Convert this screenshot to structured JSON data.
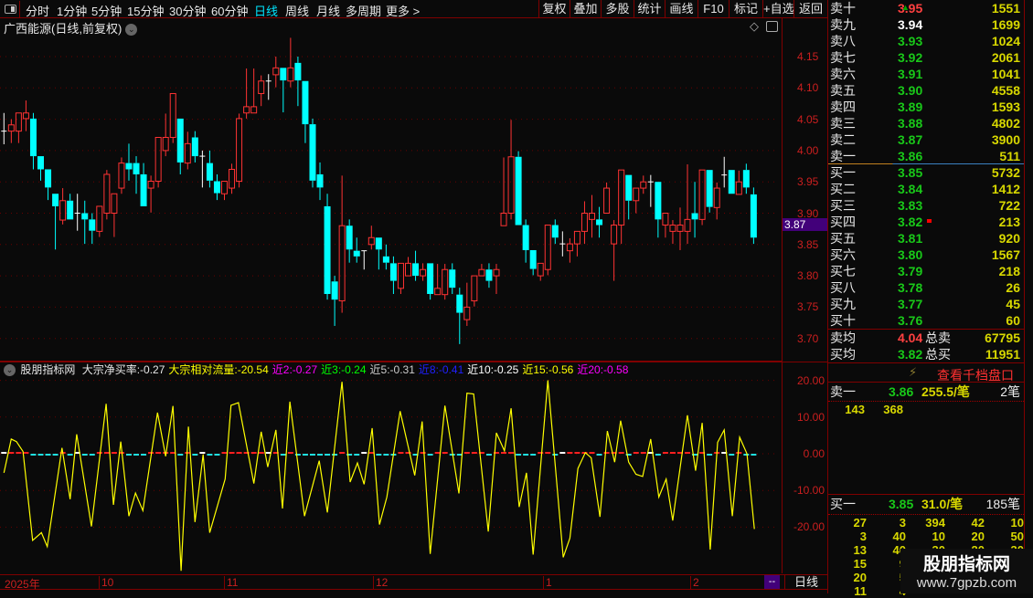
{
  "toolbar": {
    "tabs": [
      "分时",
      "1分钟",
      "5分钟",
      "15分钟",
      "30分钟",
      "60分钟",
      "日线",
      "周线",
      "月线",
      "多周期",
      "更多 >"
    ],
    "active_tab": "日线",
    "buttons": [
      "复权",
      "叠加",
      "多股",
      "统计",
      "画线",
      "F10",
      "标记",
      "+自选",
      "返回"
    ]
  },
  "title": "广西能源(日线,前复权)",
  "price_axis": {
    "ticks": [
      "4.15",
      "4.10",
      "4.05",
      "4.00",
      "3.95",
      "3.90",
      "3.85",
      "3.80",
      "3.75",
      "3.70"
    ],
    "last_price": "3.87"
  },
  "indicator": {
    "name": "股朋指标网",
    "items": [
      {
        "text": "大宗净买率:-0.27",
        "color": "#e8e8e8"
      },
      {
        "text": "大宗相对流量:-20.54",
        "color": "#ffff00"
      },
      {
        "text": "近2:-0.27",
        "color": "#ff00ff"
      },
      {
        "text": "近3:-0.24",
        "color": "#00ff00"
      },
      {
        "text": "近5:-0.31",
        "color": "#cccccc"
      },
      {
        "text": "近8:-0.41",
        "color": "#2020ff"
      },
      {
        "text": "近10:-0.25",
        "color": "#ffffff"
      },
      {
        "text": "近15:-0.56",
        "color": "#ffff00"
      },
      {
        "text": "近20:-0.58",
        "color": "#ff00ff"
      }
    ],
    "ticks": [
      "20.00",
      "10.00",
      "0.00",
      "-10.00",
      "-20.00"
    ]
  },
  "date_axis": {
    "labels": [
      "2025年",
      "10",
      "11",
      "12",
      "1",
      "2"
    ],
    "period_box": "--",
    "period": "日线"
  },
  "order_book": {
    "asks": [
      [
        "卖十",
        "3.95",
        "1551"
      ],
      [
        "卖九",
        "3.94",
        "1699"
      ],
      [
        "卖八",
        "3.93",
        "1024"
      ],
      [
        "卖七",
        "3.92",
        "2061"
      ],
      [
        "卖六",
        "3.91",
        "1041"
      ],
      [
        "卖五",
        "3.90",
        "4558"
      ],
      [
        "卖四",
        "3.89",
        "1593"
      ],
      [
        "卖三",
        "3.88",
        "4802"
      ],
      [
        "卖二",
        "3.87",
        "3900"
      ],
      [
        "卖一",
        "3.86",
        "511"
      ]
    ],
    "bids": [
      [
        "买一",
        "3.85",
        "5732"
      ],
      [
        "买二",
        "3.84",
        "1412"
      ],
      [
        "买三",
        "3.83",
        "722"
      ],
      [
        "买四",
        "3.82",
        "213"
      ],
      [
        "买五",
        "3.81",
        "920"
      ],
      [
        "买六",
        "3.80",
        "1567"
      ],
      [
        "买七",
        "3.79",
        "218"
      ],
      [
        "买八",
        "3.78",
        "26"
      ],
      [
        "买九",
        "3.77",
        "45"
      ],
      [
        "买十",
        "3.76",
        "60"
      ]
    ],
    "ask_avg": {
      "label": "卖均",
      "price": "4.04",
      "total_label": "总卖",
      "total": "67795"
    },
    "bid_avg": {
      "label": "买均",
      "price": "3.82",
      "total_label": "总买",
      "total": "11951"
    }
  },
  "depth": {
    "link": "查看千档盘口",
    "ask1": {
      "label": "卖一",
      "price": "3.86",
      "avg": "255.5/笔",
      "count": "2笔",
      "orders": [
        "143",
        "368"
      ]
    },
    "bid1": {
      "label": "买一",
      "price": "3.85",
      "avg": "31.0/笔",
      "count": "185笔",
      "orders": [
        [
          "27",
          "3",
          "394",
          "42",
          "10"
        ],
        [
          "3",
          "40",
          "10",
          "20",
          "50"
        ],
        [
          "13",
          "40",
          "30",
          "20",
          "30"
        ],
        [
          "15",
          "9"
        ],
        [
          "20",
          "5"
        ],
        [
          "11",
          "4"
        ]
      ]
    }
  },
  "watermark": {
    "name": "股朋指标网",
    "url": "www.7gpzb.com"
  },
  "colors": {
    "up": "#ff3333",
    "down": "#00ffff",
    "flat": "#ffffff",
    "line": "#ffff00",
    "grid": "#6a0000",
    "axis": "#cc1f1f"
  },
  "chart_data": [
    {
      "type": "candlestick",
      "title": "广西能源(日线,前复权)",
      "ylim": [
        3.67,
        4.18
      ],
      "fields": [
        "open",
        "high",
        "low",
        "close"
      ],
      "ohlc": [
        [
          4.031,
          4.06,
          4.01,
          4.031
        ],
        [
          4.031,
          4.05,
          4.012,
          4.041
        ],
        [
          4.031,
          4.06,
          4.012,
          4.06
        ],
        [
          4.051,
          4.08,
          4.031,
          4.06
        ],
        [
          4.051,
          4.06,
          3.97,
          3.991
        ],
        [
          3.991,
          3.991,
          3.952,
          3.97
        ],
        [
          3.97,
          3.97,
          3.921,
          3.941
        ],
        [
          3.931,
          3.931,
          3.842,
          3.911
        ],
        [
          3.889,
          3.94,
          3.882,
          3.92
        ],
        [
          3.92,
          3.931,
          3.89,
          3.89
        ],
        [
          3.9,
          3.931,
          3.872,
          3.9
        ],
        [
          3.9,
          3.92,
          3.851,
          3.89
        ],
        [
          3.89,
          3.9,
          3.851,
          3.872
        ],
        [
          3.871,
          3.911,
          3.862,
          3.911
        ],
        [
          3.9,
          3.969,
          3.89,
          3.962
        ],
        [
          3.9,
          3.931,
          3.862,
          3.931
        ],
        [
          3.94,
          3.989,
          3.931,
          3.98
        ],
        [
          3.98,
          4.011,
          3.952,
          3.97
        ],
        [
          3.98,
          3.991,
          3.931,
          3.962
        ],
        [
          3.962,
          3.98,
          3.911,
          3.911
        ],
        [
          3.94,
          3.96,
          3.901,
          3.951
        ],
        [
          3.951,
          4.021,
          3.941,
          4.021
        ],
        [
          4.0,
          4.059,
          3.991,
          4.021
        ],
        [
          4.021,
          4.091,
          4.012,
          4.091
        ],
        [
          4.051,
          4.051,
          3.962,
          3.981
        ],
        [
          3.98,
          4.03,
          3.97,
          4.011
        ],
        [
          4.021,
          4.031,
          3.981,
          3.991
        ],
        [
          3.991,
          4.0,
          3.941,
          3.991
        ],
        [
          3.98,
          4.0,
          3.941,
          3.952
        ],
        [
          3.951,
          3.962,
          3.921,
          3.932
        ],
        [
          3.931,
          3.951,
          3.921,
          3.951
        ],
        [
          3.94,
          3.979,
          3.931,
          3.97
        ],
        [
          3.951,
          4.059,
          3.941,
          4.051
        ],
        [
          4.06,
          4.131,
          4.051,
          4.07
        ],
        [
          4.06,
          4.131,
          4.06,
          4.07
        ],
        [
          4.091,
          4.12,
          4.071,
          4.111
        ],
        [
          4.111,
          4.122,
          4.081,
          4.111
        ],
        [
          4.121,
          4.15,
          4.101,
          4.132
        ],
        [
          4.132,
          4.132,
          4.061,
          4.112
        ],
        [
          4.111,
          4.18,
          4.101,
          4.132
        ],
        [
          4.14,
          4.15,
          4.071,
          4.112
        ],
        [
          4.111,
          4.111,
          4.012,
          4.042
        ],
        [
          4.042,
          4.051,
          3.941,
          3.952
        ],
        [
          3.962,
          3.981,
          3.921,
          3.941
        ],
        [
          3.911,
          3.931,
          3.762,
          3.771
        ],
        [
          3.791,
          3.8,
          3.72,
          3.762
        ],
        [
          3.76,
          3.96,
          3.741,
          3.88
        ],
        [
          3.88,
          3.89,
          3.821,
          3.842
        ],
        [
          3.84,
          3.861,
          3.821,
          3.831
        ],
        [
          3.84,
          3.84,
          3.81,
          3.84
        ],
        [
          3.85,
          3.88,
          3.842,
          3.861
        ],
        [
          3.861,
          3.861,
          3.81,
          3.842
        ],
        [
          3.831,
          3.85,
          3.81,
          3.821
        ],
        [
          3.82,
          3.831,
          3.771,
          3.792
        ],
        [
          3.78,
          3.82,
          3.771,
          3.82
        ],
        [
          3.8,
          3.83,
          3.8,
          3.82
        ],
        [
          3.82,
          3.84,
          3.792,
          3.8
        ],
        [
          3.8,
          3.82,
          3.792,
          3.81
        ],
        [
          3.82,
          3.82,
          3.762,
          3.771
        ],
        [
          3.77,
          3.819,
          3.77,
          3.78
        ],
        [
          3.77,
          3.819,
          3.762,
          3.81
        ],
        [
          3.81,
          3.82,
          3.771,
          3.781
        ],
        [
          3.77,
          3.781,
          3.691,
          3.741
        ],
        [
          3.73,
          3.789,
          3.72,
          3.75
        ],
        [
          3.76,
          3.8,
          3.751,
          3.8
        ],
        [
          3.8,
          3.819,
          3.8,
          3.81
        ],
        [
          3.81,
          3.82,
          3.781,
          3.792
        ],
        [
          3.8,
          3.819,
          3.771,
          3.81
        ],
        [
          3.88,
          3.989,
          3.88,
          3.9
        ],
        [
          3.9,
          4.049,
          3.89,
          3.99
        ],
        [
          3.99,
          3.999,
          3.881,
          3.881
        ],
        [
          3.881,
          3.89,
          3.821,
          3.841
        ],
        [
          3.841,
          3.841,
          3.801,
          3.811
        ],
        [
          3.8,
          3.82,
          3.792,
          3.82
        ],
        [
          3.81,
          3.881,
          3.801,
          3.881
        ],
        [
          3.881,
          3.89,
          3.851,
          3.861
        ],
        [
          3.851,
          3.871,
          3.831,
          3.851
        ],
        [
          3.84,
          3.86,
          3.821,
          3.851
        ],
        [
          3.851,
          3.871,
          3.831,
          3.871
        ],
        [
          3.871,
          3.919,
          3.851,
          3.9
        ],
        [
          3.89,
          3.929,
          3.861,
          3.9
        ],
        [
          3.89,
          3.91,
          3.861,
          3.881
        ],
        [
          3.9,
          3.949,
          3.9,
          3.94
        ],
        [
          3.851,
          3.889,
          3.792,
          3.881
        ],
        [
          3.881,
          3.969,
          3.851,
          3.969
        ],
        [
          3.961,
          3.961,
          3.89,
          3.92
        ],
        [
          3.92,
          3.94,
          3.9,
          3.94
        ],
        [
          3.94,
          3.96,
          3.931,
          3.95
        ],
        [
          3.95,
          3.961,
          3.91,
          3.95
        ],
        [
          3.95,
          3.95,
          3.861,
          3.89
        ],
        [
          3.881,
          3.9,
          3.861,
          3.9
        ],
        [
          3.871,
          3.889,
          3.851,
          3.881
        ],
        [
          3.871,
          3.909,
          3.841,
          3.881
        ],
        [
          3.871,
          3.978,
          3.851,
          3.89
        ],
        [
          3.9,
          3.95,
          3.861,
          3.89
        ],
        [
          3.89,
          3.969,
          3.881,
          3.969
        ],
        [
          3.969,
          3.969,
          3.901,
          3.91
        ],
        [
          3.909,
          3.949,
          3.89,
          3.94
        ],
        [
          3.961,
          3.99,
          3.941,
          3.961
        ],
        [
          3.969,
          3.969,
          3.931,
          3.931
        ],
        [
          3.93,
          3.968,
          3.93,
          3.95
        ],
        [
          3.969,
          3.979,
          3.931,
          3.941
        ],
        [
          3.93,
          3.941,
          3.851,
          3.861
        ]
      ]
    },
    {
      "type": "line",
      "name": "大宗相对流量",
      "ylim": [
        -32,
        24
      ],
      "x_unit": "bar index",
      "points": [
        [
          0,
          -5.2
        ],
        [
          1,
          4.0
        ],
        [
          1.7,
          3.3
        ],
        [
          2.6,
          0.6
        ],
        [
          3.9,
          -23.6
        ],
        [
          5.1,
          -21.5
        ],
        [
          5.9,
          -25.3
        ],
        [
          7.9,
          1.6
        ],
        [
          9,
          -12.4
        ],
        [
          9.9,
          5.3
        ],
        [
          11.9,
          -19.8
        ],
        [
          13.9,
          13.6
        ],
        [
          14.9,
          -13.9
        ],
        [
          15.9,
          3.3
        ],
        [
          17,
          -17.0
        ],
        [
          17.9,
          -10.7
        ],
        [
          18.9,
          -15.5
        ],
        [
          20.9,
          11.2
        ],
        [
          22,
          -0.7
        ],
        [
          23,
          13.0
        ],
        [
          24.1,
          -31.9
        ],
        [
          25.1,
          7.4
        ],
        [
          26,
          -18.6
        ],
        [
          27.1,
          -0.2
        ],
        [
          28,
          -21.5
        ],
        [
          30.1,
          -6.9
        ],
        [
          30.9,
          13.2
        ],
        [
          31.9,
          13.9
        ],
        [
          34,
          -8.1
        ],
        [
          35,
          6.0
        ],
        [
          35.9,
          -3.6
        ],
        [
          37,
          6.5
        ],
        [
          37.9,
          -14.9
        ],
        [
          38.9,
          14.2
        ],
        [
          40.9,
          -17.0
        ],
        [
          42.9,
          -1.9
        ],
        [
          44,
          -16.0
        ],
        [
          46,
          19.6
        ],
        [
          47.1,
          -7.7
        ],
        [
          48.1,
          -2.5
        ],
        [
          49,
          -8.3
        ],
        [
          50.1,
          7.0
        ],
        [
          51.1,
          -19.3
        ],
        [
          52.1,
          -11.8
        ],
        [
          53.9,
          11.6
        ],
        [
          55.9,
          -5.9
        ],
        [
          56.9,
          8.8
        ],
        [
          58,
          -27.3
        ],
        [
          60,
          13.1
        ],
        [
          61.9,
          -10.8
        ],
        [
          63,
          16.5
        ],
        [
          63.9,
          16.3
        ],
        [
          65.9,
          -21.2
        ],
        [
          67,
          5.7
        ],
        [
          68.1,
          0.8
        ],
        [
          69,
          12.4
        ],
        [
          70.1,
          -14.5
        ],
        [
          71.1,
          -5.2
        ],
        [
          72,
          -27.5
        ],
        [
          74,
          20.0
        ],
        [
          76.1,
          -28.2
        ],
        [
          77,
          -23.0
        ],
        [
          78.1,
          -4.0
        ],
        [
          79.1,
          0.3
        ],
        [
          79.9,
          -1.1
        ],
        [
          81.1,
          -17.2
        ],
        [
          82.1,
          6.2
        ],
        [
          83.1,
          -2.3
        ],
        [
          83.9,
          9.0
        ],
        [
          85,
          -2.3
        ],
        [
          86,
          -5.6
        ],
        [
          86.9,
          -6.2
        ],
        [
          88,
          4.0
        ],
        [
          89.1,
          -11.8
        ],
        [
          90.1,
          -6.9
        ],
        [
          91,
          -18.2
        ],
        [
          93,
          10.5
        ],
        [
          94.1,
          -4.6
        ],
        [
          95,
          8.4
        ],
        [
          96.1,
          -26.1
        ],
        [
          97.1,
          3.1
        ],
        [
          98,
          6.5
        ],
        [
          99.1,
          -17.0
        ],
        [
          100.1,
          4.5
        ],
        [
          101.1,
          0.0
        ],
        [
          102.1,
          -20.5
        ]
      ]
    }
  ]
}
